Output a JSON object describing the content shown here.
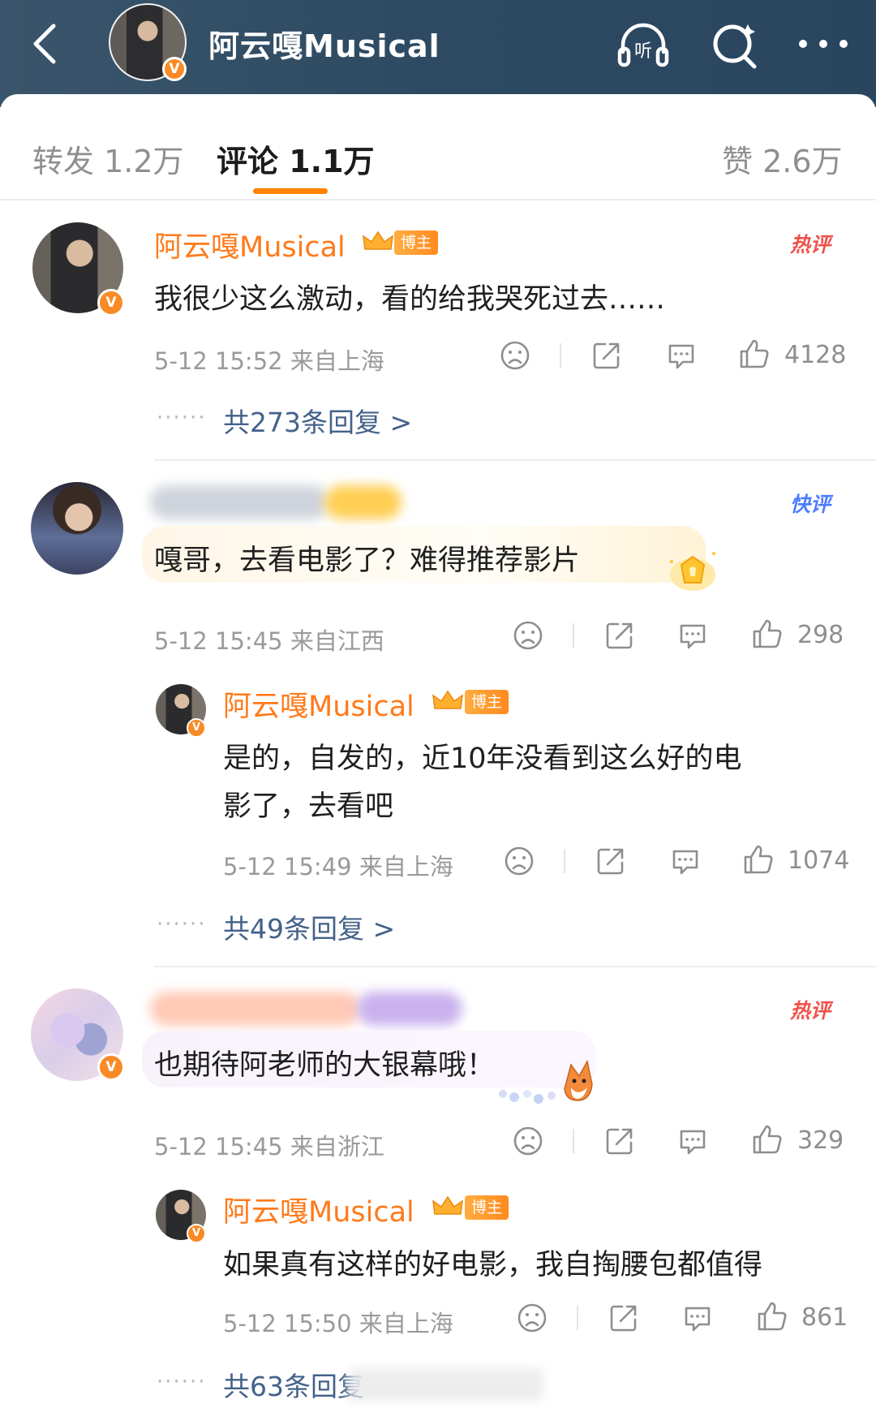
{
  "header": {
    "title": "阿云嘎Musical",
    "v_mark": "V"
  },
  "tabs": [
    {
      "label": "转发 1.2万"
    },
    {
      "label": "评论 1.1万"
    },
    {
      "label": "赞 2.6万"
    }
  ],
  "comments": [
    {
      "author": "阿云嘎Musical",
      "author_tag": "博主",
      "badge": "热评",
      "text": "我很少这么激动，看的给我哭死过去……",
      "meta": "5-12 15:52 来自上海",
      "likes": "4128",
      "replies_label": "共273条回复 >"
    },
    {
      "badge": "快评",
      "text": "嘎哥，去看电影了？难得推荐影片",
      "meta": "5-12 15:45 来自江西",
      "likes": "298",
      "reply": {
        "author": "阿云嘎Musical",
        "author_tag": "博主",
        "text_line1": "是的，自发的，近10年没看到这么好的电",
        "text_line2": "影了，去看吧",
        "meta": "5-12 15:49 来自上海",
        "likes": "1074"
      },
      "replies_label": "共49条回复 >"
    },
    {
      "badge": "热评",
      "text": "也期待阿老师的大银幕哦！",
      "meta": "5-12 15:45 来自浙江",
      "likes": "329",
      "reply": {
        "author": "阿云嘎Musical",
        "author_tag": "博主",
        "text_line1": "如果真有这样的好电影，我自掏腰包都值得",
        "meta": "5-12 15:50 来自上海",
        "likes": "861"
      },
      "replies_label": "共63条回复"
    }
  ],
  "ui": {
    "dots": "······"
  },
  "colors": {
    "header_bg": "#2d4a62",
    "accent_orange": "#ff8200",
    "name_orange": "#ff7a1a",
    "link_blue": "#43628a",
    "hot_red": "#f0524a",
    "fast_blue": "#4d7cff"
  }
}
